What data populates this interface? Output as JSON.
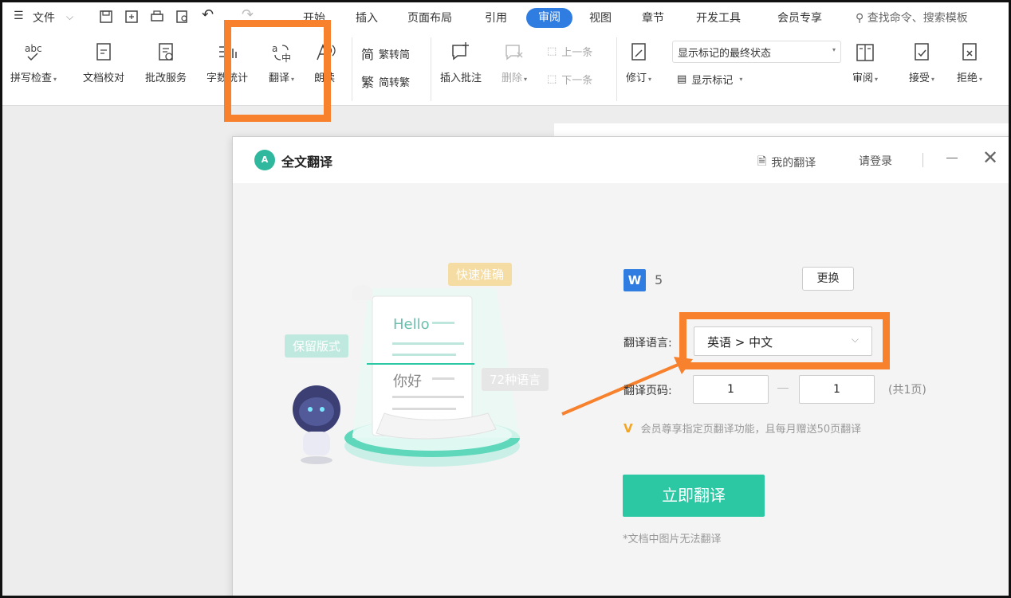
{
  "menubar": {
    "file_label": "文件",
    "tabs": [
      "开始",
      "插入",
      "页面布局",
      "引用",
      "审阅",
      "视图",
      "章节",
      "开发工具",
      "会员专享"
    ],
    "active_tab": "审阅",
    "search_placeholder": "查找命令、搜索模板"
  },
  "ribbon": {
    "spell_check": "拼写检查",
    "doc_proof": "文档校对",
    "review_service": "批改服务",
    "word_count": "字数统计",
    "translate": "翻译",
    "read_aloud": "朗读",
    "trad_to_simp": "繁转简",
    "simp_to_trad": "简转繁",
    "insert_comment": "插入批注",
    "delete": "删除",
    "prev": "上一条",
    "next": "下一条",
    "revise": "修订",
    "markup_state": "显示标记的最终状态",
    "show_markup": "显示标记",
    "review": "审阅",
    "accept": "接受",
    "reject": "拒绝"
  },
  "dialog": {
    "logo_text": "A",
    "title": "全文翻译",
    "my_translations": "我的翻译",
    "login": "请登录",
    "illustration": {
      "hello": "Hello",
      "nihao": "你好",
      "bubble_fast": "快速准确",
      "bubble_layout": "保留版式",
      "bubble_langs": "72种语言"
    },
    "file_icon": "W",
    "file_count": "5",
    "change_button": "更换",
    "language_label": "翻译语言:",
    "language_value": "英语 > 中文",
    "pages_label": "翻译页码:",
    "page_from": "1",
    "page_to": "1",
    "total_pages": "(共1页)",
    "vip_note": "会员尊享指定页翻译功能，且每月赠送50页翻译",
    "translate_button": "立即翻译",
    "footnote": "*文档中图片无法翻译"
  },
  "colors": {
    "accent_blue": "#2f7de1",
    "highlight_orange": "#f7812c",
    "primary_green": "#2cc8a4"
  }
}
